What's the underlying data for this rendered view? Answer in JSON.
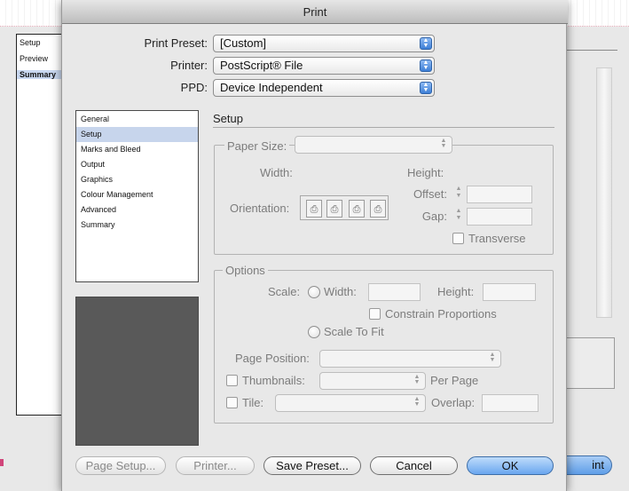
{
  "background_window": {
    "sidebar_items": [
      "Setup",
      "Preview",
      "Summary"
    ],
    "print_button_partial": "int"
  },
  "dialog": {
    "title": "Print",
    "preset": {
      "label": "Print Preset:",
      "value": "[Custom]"
    },
    "printer": {
      "label": "Printer:",
      "value": "PostScript® File"
    },
    "ppd": {
      "label": "PPD:",
      "value": "Device Independent"
    },
    "categories": [
      "General",
      "Setup",
      "Marks and Bleed",
      "Output",
      "Graphics",
      "Colour Management",
      "Advanced",
      "Summary"
    ],
    "selected_category": "Setup",
    "setup": {
      "title": "Setup",
      "paper_size_label": "Paper Size:",
      "width_label": "Width:",
      "height_label": "Height:",
      "offset_label": "Offset:",
      "orientation_label": "Orientation:",
      "gap_label": "Gap:",
      "transverse_label": "Transverse"
    },
    "options": {
      "title": "Options",
      "scale_label": "Scale:",
      "width_label": "Width:",
      "height_label": "Height:",
      "constrain_label": "Constrain Proportions",
      "scale_to_fit_label": "Scale To Fit",
      "page_position_label": "Page Position:",
      "thumbnails_label": "Thumbnails:",
      "per_page_label": "Per Page",
      "tile_label": "Tile:",
      "overlap_label": "Overlap:"
    },
    "buttons": {
      "page_setup": "Page Setup...",
      "printer": "Printer...",
      "save_preset": "Save Preset...",
      "cancel": "Cancel",
      "ok": "OK"
    }
  }
}
